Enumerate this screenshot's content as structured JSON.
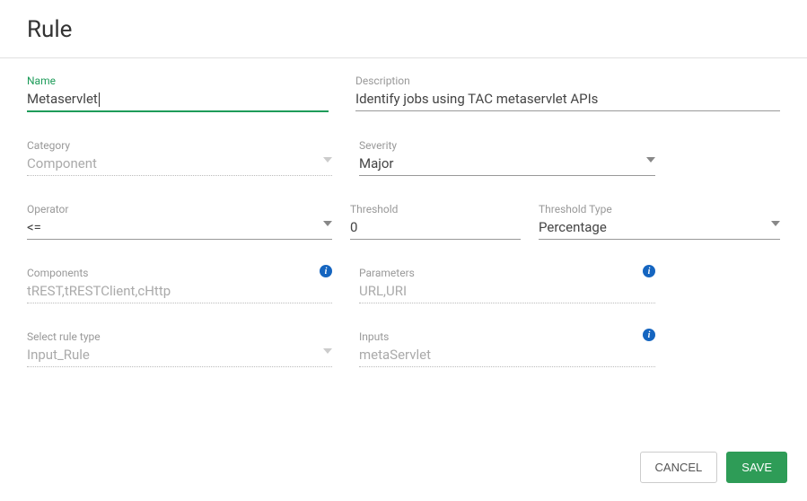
{
  "dialog": {
    "title": "Rule"
  },
  "fields": {
    "name": {
      "label": "Name",
      "value": "Metaservlet"
    },
    "description": {
      "label": "Description",
      "value": "Identify jobs using TAC metaservlet APIs"
    },
    "category": {
      "label": "Category",
      "value": "Component"
    },
    "severity": {
      "label": "Severity",
      "value": "Major"
    },
    "operator": {
      "label": "Operator",
      "value": "<="
    },
    "threshold": {
      "label": "Threshold",
      "value": "0"
    },
    "thresholdType": {
      "label": "Threshold Type",
      "value": "Percentage"
    },
    "components": {
      "label": "Components",
      "value": "tREST,tRESTClient,cHttp"
    },
    "parameters": {
      "label": "Parameters",
      "value": "URL,URI"
    },
    "ruleType": {
      "label": "Select rule type",
      "value": "Input_Rule"
    },
    "inputs": {
      "label": "Inputs",
      "value": "metaServlet"
    }
  },
  "buttons": {
    "cancel": "CANCEL",
    "save": "SAVE"
  }
}
